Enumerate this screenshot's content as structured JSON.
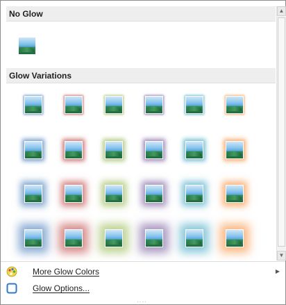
{
  "no_glow": {
    "header": "No Glow"
  },
  "glow_variations": {
    "header": "Glow Variations",
    "colors": [
      "#4f81bd",
      "#c0504d",
      "#9bbb59",
      "#8064a2",
      "#4bacc6",
      "#f79646"
    ],
    "color_names": [
      "blue-glow",
      "red-glow",
      "green-glow",
      "purple-glow",
      "aqua-glow",
      "orange-glow"
    ],
    "sizes": [
      "5pt",
      "8pt",
      "11pt",
      "18pt"
    ]
  },
  "menu": {
    "more_colors": "More Glow Colors",
    "glow_options": "Glow Options..."
  },
  "icons": {
    "more_colors": "palette-icon",
    "glow_options": "glow-options-icon",
    "submenu": "chevron-right-icon",
    "scroll_up": "scroll-up-arrow-icon",
    "scroll_down": "scroll-down-arrow-icon"
  },
  "scroll_glyphs": {
    "up": "▲",
    "down": "▼"
  },
  "submenu_glyph": "▶",
  "gripper_glyph": "····"
}
